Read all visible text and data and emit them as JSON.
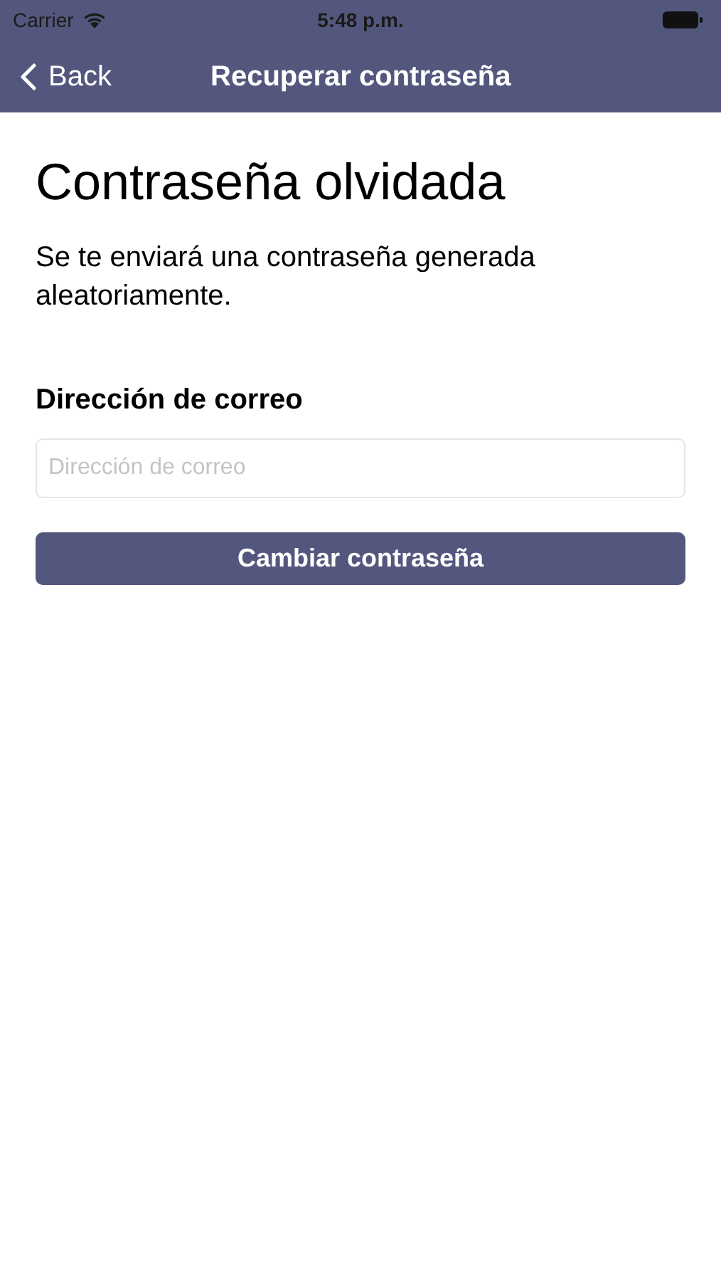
{
  "status_bar": {
    "carrier": "Carrier",
    "time": "5:48 p.m."
  },
  "nav_bar": {
    "back": "Back",
    "title": "Recuperar contraseña"
  },
  "heading": "Contraseña olvidada",
  "description": "Se te enviará una contraseña generada aleatoriamente.",
  "email_field": {
    "label": "Dirección de correo",
    "placeholder": "Dirección de correo"
  },
  "submit_button": "Cambiar contraseña"
}
